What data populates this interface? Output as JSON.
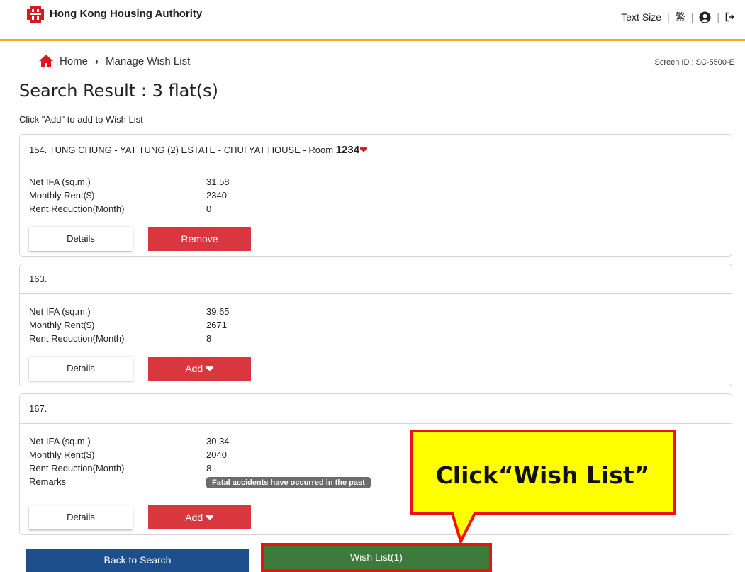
{
  "header": {
    "brand": "Hong Kong Housing Authority",
    "text_size": "Text Size",
    "lang": "繁",
    "logo_color": "#d71920",
    "accent": "#f5a623"
  },
  "breadcrumb": {
    "home": "Home",
    "current": "Manage Wish List",
    "screen_id": "Screen ID : SC-5500-E"
  },
  "page": {
    "title": "Search Result : 3 flat(s)",
    "instruction": "Click \"Add\" to add to Wish List"
  },
  "labels": {
    "net_ifa": "Net IFA (sq.m.)",
    "monthly_rent": "Monthly Rent($)",
    "rent_reduction": "Rent Reduction(Month)",
    "remarks": "Remarks",
    "details": "Details"
  },
  "flats": [
    {
      "title": "154. TUNG CHUNG - YAT TUNG (2) ESTATE - CHUI YAT HOUSE - Room ",
      "room": "1234",
      "net_ifa": "31.58",
      "monthly_rent": "2340",
      "rent_reduction": "0",
      "action": "Remove"
    },
    {
      "title": "163.",
      "net_ifa": "39.65",
      "monthly_rent": "2671",
      "rent_reduction": "8",
      "action": "Add"
    },
    {
      "title": "167.",
      "net_ifa": "30.34",
      "monthly_rent": "2040",
      "rent_reduction": "8",
      "remark": "Fatal accidents have occurred in the past",
      "action": "Add"
    }
  ],
  "footer": {
    "back": "Back to Search",
    "wish_list": "Wish List(1)"
  },
  "callout": {
    "text": "Click“Wish List”",
    "fill": "#ffff00",
    "border": "#ee1111"
  }
}
